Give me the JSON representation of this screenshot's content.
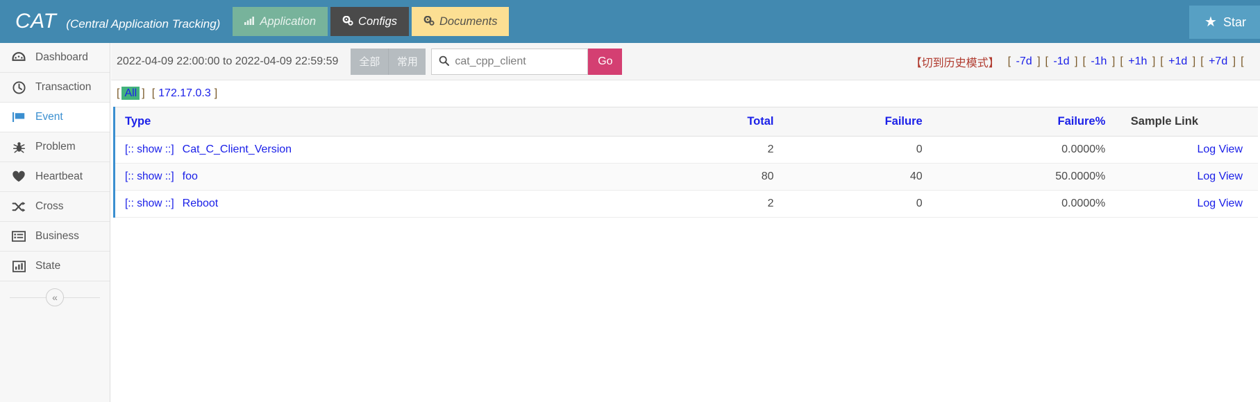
{
  "header": {
    "brand_main": "CAT",
    "brand_sub": "(Central Application Tracking)",
    "nav": [
      {
        "label": "Application",
        "icon": "bar-chart-icon",
        "state": "muted"
      },
      {
        "label": "Configs",
        "icon": "gears-icon",
        "state": "dark"
      },
      {
        "label": "Documents",
        "icon": "gears-icon",
        "state": "yellow"
      }
    ],
    "star_label": "Star",
    "star_icon": "star-icon",
    "bg_color": "#4289b0"
  },
  "sidebar": {
    "items": [
      {
        "label": "Dashboard",
        "icon": "dashboard-icon",
        "active": false
      },
      {
        "label": "Transaction",
        "icon": "clock-icon",
        "active": false
      },
      {
        "label": "Event",
        "icon": "flag-icon",
        "active": true
      },
      {
        "label": "Problem",
        "icon": "bug-icon",
        "active": false
      },
      {
        "label": "Heartbeat",
        "icon": "heart-icon",
        "active": false
      },
      {
        "label": "Cross",
        "icon": "shuffle-icon",
        "active": false
      },
      {
        "label": "Business",
        "icon": "list-icon",
        "active": false
      },
      {
        "label": "State",
        "icon": "chart-icon",
        "active": false
      }
    ],
    "collapse_icon": "«"
  },
  "filterbar": {
    "date_range": "2022-04-09 22:00:00 to 2022-04-09 22:59:59",
    "segments": [
      {
        "label": "全部"
      },
      {
        "label": "常用"
      }
    ],
    "search_icon": "search-icon",
    "search_value": "cat_cpp_client",
    "search_placeholder": "cat_cpp_client",
    "go_label": "Go",
    "go_color": "#d43f72",
    "history_mode": "【切到历史模式】",
    "shifts": [
      {
        "open": "[",
        "label": "-7d",
        "close": "]"
      },
      {
        "open": "[",
        "label": "-1d",
        "close": "]"
      },
      {
        "open": "[",
        "label": "-1h",
        "close": "]"
      },
      {
        "open": "[",
        "label": "+1h",
        "close": "]"
      },
      {
        "open": "[",
        "label": "+1d",
        "close": "]"
      },
      {
        "open": "[",
        "label": "+7d",
        "close": "]"
      },
      {
        "open": "[",
        "label": "",
        "close": ""
      }
    ]
  },
  "iprow": {
    "all_open": "[",
    "all_label": "All",
    "all_close": "]",
    "ip_open": "[",
    "ip_label": "172.17.0.3",
    "ip_close": "]"
  },
  "table": {
    "columns": [
      {
        "key": "type",
        "label": "Type",
        "align": "left"
      },
      {
        "key": "total",
        "label": "Total",
        "align": "right"
      },
      {
        "key": "failure",
        "label": "Failure",
        "align": "right"
      },
      {
        "key": "failure_pct",
        "label": "Failure%",
        "align": "right"
      },
      {
        "key": "sample_link",
        "label": "Sample Link",
        "align": "right"
      }
    ],
    "show_label": "[:: show ::]",
    "rows": [
      {
        "type": "Cat_C_Client_Version",
        "total": "2",
        "failure": "0",
        "failure_pct": "0.0000%",
        "sample_link": "Log View"
      },
      {
        "type": "foo",
        "total": "80",
        "failure": "40",
        "failure_pct": "50.0000%",
        "sample_link": "Log View"
      },
      {
        "type": "Reboot",
        "total": "2",
        "failure": "0",
        "failure_pct": "0.0000%",
        "sample_link": "Log View"
      }
    ]
  }
}
